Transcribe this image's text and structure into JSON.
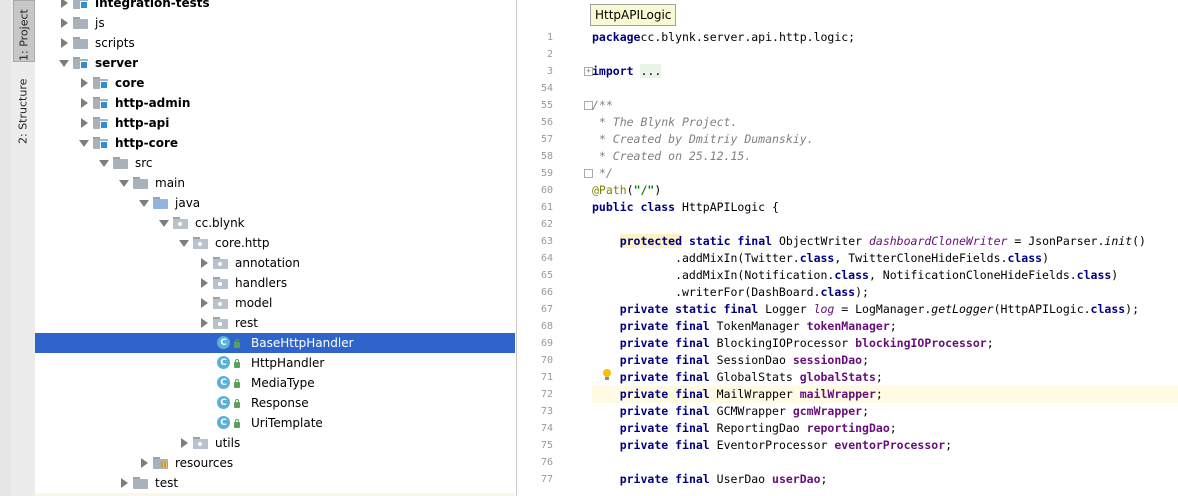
{
  "toolwindow": {
    "project_label": "1: Project",
    "structure_label": "2: Structure"
  },
  "tree": {
    "rows": [
      {
        "label": "integration-tests",
        "arrow": "right",
        "icon": "module-folder",
        "bold": true
      },
      {
        "label": "js",
        "arrow": "right",
        "icon": "folder",
        "bold": false
      },
      {
        "label": "scripts",
        "arrow": "right",
        "icon": "folder",
        "bold": false
      },
      {
        "label": "server",
        "arrow": "down",
        "icon": "module-folder",
        "bold": true
      },
      {
        "label": "core",
        "arrow": "right",
        "icon": "module-folder",
        "bold": true
      },
      {
        "label": "http-admin",
        "arrow": "right",
        "icon": "module-folder",
        "bold": true
      },
      {
        "label": "http-api",
        "arrow": "right",
        "icon": "module-folder",
        "bold": true
      },
      {
        "label": "http-core",
        "arrow": "down",
        "icon": "module-folder",
        "bold": true
      },
      {
        "label": "src",
        "arrow": "down",
        "icon": "folder",
        "bold": false
      },
      {
        "label": "main",
        "arrow": "down",
        "icon": "folder",
        "bold": false
      },
      {
        "label": "java",
        "arrow": "down",
        "icon": "source-folder",
        "bold": false
      },
      {
        "label": "cc.blynk",
        "arrow": "down",
        "icon": "package",
        "bold": false
      },
      {
        "label": "core.http",
        "arrow": "down",
        "icon": "package",
        "bold": false
      },
      {
        "label": "annotation",
        "arrow": "right",
        "icon": "package",
        "bold": false
      },
      {
        "label": "handlers",
        "arrow": "right",
        "icon": "package",
        "bold": false
      },
      {
        "label": "model",
        "arrow": "right",
        "icon": "package",
        "bold": false
      },
      {
        "label": "rest",
        "arrow": "right",
        "icon": "package",
        "bold": false
      },
      {
        "label": "BaseHttpHandler",
        "arrow": "",
        "icon": "class",
        "bold": false,
        "selected": true
      },
      {
        "label": "HttpHandler",
        "arrow": "",
        "icon": "class",
        "bold": false
      },
      {
        "label": "MediaType",
        "arrow": "",
        "icon": "class",
        "bold": false
      },
      {
        "label": "Response",
        "arrow": "",
        "icon": "class",
        "bold": false
      },
      {
        "label": "UriTemplate",
        "arrow": "",
        "icon": "class",
        "bold": false
      },
      {
        "label": "utils",
        "arrow": "right",
        "icon": "package",
        "bold": false
      },
      {
        "label": "resources",
        "arrow": "right",
        "icon": "resources-folder",
        "bold": false
      },
      {
        "label": "test",
        "arrow": "right",
        "icon": "folder",
        "bold": false
      }
    ],
    "class_icon_letter": "C"
  },
  "editor": {
    "breadcrumb": "HttpAPILogic",
    "lines": [
      {
        "n": "1",
        "t": [
          [
            "kw",
            "package"
          ],
          [
            "",
            "cc.blynk.server.api.http.logic;"
          ]
        ]
      },
      {
        "n": "2",
        "t": []
      },
      {
        "n": "3",
        "t": [
          [
            "kw",
            "import"
          ],
          [
            "",
            " "
          ],
          [
            "fold-txt",
            "..."
          ]
        ],
        "fold": "+"
      },
      {
        "n": "54",
        "t": []
      },
      {
        "n": "55",
        "t": [
          [
            "cmt",
            "/**"
          ]
        ],
        "fold": "-"
      },
      {
        "n": "56",
        "t": [
          [
            "cmt",
            " * The Blynk Project."
          ]
        ]
      },
      {
        "n": "57",
        "t": [
          [
            "cmt",
            " * Created by Dmitriy Dumanskiy."
          ]
        ]
      },
      {
        "n": "58",
        "t": [
          [
            "cmt",
            " * Created on 25.12.15."
          ]
        ]
      },
      {
        "n": "59",
        "t": [
          [
            "cmt",
            " */"
          ]
        ],
        "fold": "-"
      },
      {
        "n": "60",
        "t": [
          [
            "ann",
            "@Path"
          ],
          [
            "",
            "("
          ],
          [
            "str",
            "\"/\""
          ],
          [
            "",
            ")"
          ]
        ]
      },
      {
        "n": "61",
        "t": [
          [
            "kw",
            "public class"
          ],
          [
            "",
            " HttpAPILogic {"
          ]
        ]
      },
      {
        "n": "62",
        "t": []
      },
      {
        "n": "63",
        "t": [
          [
            "",
            "    "
          ],
          [
            "kw hl",
            "protected"
          ],
          [
            "",
            " "
          ],
          [
            "kw",
            "static final"
          ],
          [
            "",
            " ObjectWriter "
          ],
          [
            "ifld",
            "dashboardCloneWriter"
          ],
          [
            "",
            " = JsonParser."
          ],
          [
            "mit",
            "init"
          ],
          [
            "",
            "()"
          ]
        ]
      },
      {
        "n": "64",
        "t": [
          [
            "",
            "            .addMixIn(Twitter."
          ],
          [
            "kw",
            "class"
          ],
          [
            "",
            ", TwitterCloneHideFields."
          ],
          [
            "kw",
            "class"
          ],
          [
            ")"
          ]
        ]
      },
      {
        "n": "65",
        "t": [
          [
            "",
            "            .addMixIn(Notification."
          ],
          [
            "kw",
            "class"
          ],
          [
            "",
            ", NotificationCloneHideFields."
          ],
          [
            "kw",
            "class"
          ],
          [
            ")"
          ]
        ]
      },
      {
        "n": "66",
        "t": [
          [
            "",
            "            .writerFor(DashBoard."
          ],
          [
            "kw",
            "class"
          ],
          [
            "",
            ");"
          ]
        ]
      },
      {
        "n": "67",
        "t": [
          [
            "",
            "    "
          ],
          [
            "kw",
            "private static final"
          ],
          [
            "",
            " Logger "
          ],
          [
            "ifld",
            "log"
          ],
          [
            "",
            " = LogManager."
          ],
          [
            "mit",
            "getLogger"
          ],
          [
            "",
            "(HttpAPILogic."
          ],
          [
            "kw",
            "class"
          ],
          [
            "",
            ");"
          ]
        ]
      },
      {
        "n": "68",
        "t": [
          [
            "",
            "    "
          ],
          [
            "kw",
            "private final"
          ],
          [
            "",
            " TokenManager "
          ],
          [
            "fld",
            "tokenManager"
          ],
          [
            ";"
          ]
        ]
      },
      {
        "n": "69",
        "t": [
          [
            "",
            "    "
          ],
          [
            "kw",
            "private final"
          ],
          [
            "",
            " BlockingIOProcessor "
          ],
          [
            "fld",
            "blockingIOProcessor"
          ],
          [
            ";"
          ]
        ]
      },
      {
        "n": "70",
        "t": [
          [
            "",
            "    "
          ],
          [
            "kw",
            "private final"
          ],
          [
            "",
            " SessionDao "
          ],
          [
            "fld",
            "sessionDao"
          ],
          [
            ";"
          ]
        ]
      },
      {
        "n": "71",
        "t": [
          [
            "",
            "    "
          ],
          [
            "kw",
            "private final"
          ],
          [
            "",
            " GlobalStats "
          ],
          [
            "fld",
            "globalStats"
          ],
          [
            ";"
          ]
        ]
      },
      {
        "n": "72",
        "t": [
          [
            "",
            "    "
          ],
          [
            "kw",
            "private final"
          ],
          [
            "",
            " MailWrapper "
          ],
          [
            "fld",
            "mailWrapper"
          ],
          [
            ";"
          ]
        ],
        "current": true
      },
      {
        "n": "73",
        "t": [
          [
            "",
            "    "
          ],
          [
            "kw",
            "private final"
          ],
          [
            "",
            " GCMWrapper "
          ],
          [
            "fld",
            "gcmWrapper"
          ],
          [
            ";"
          ]
        ]
      },
      {
        "n": "74",
        "t": [
          [
            "",
            "    "
          ],
          [
            "kw",
            "private final"
          ],
          [
            "",
            " ReportingDao "
          ],
          [
            "fld",
            "reportingDao"
          ],
          [
            ";"
          ]
        ]
      },
      {
        "n": "75",
        "t": [
          [
            "",
            "    "
          ],
          [
            "kw",
            "private final"
          ],
          [
            "",
            " EventorProcessor "
          ],
          [
            "fld",
            "eventorProcessor"
          ],
          [
            ";"
          ]
        ]
      },
      {
        "n": "76",
        "t": []
      },
      {
        "n": "77",
        "t": [
          [
            "",
            "    "
          ],
          [
            "kw",
            "private final"
          ],
          [
            "",
            " UserDao "
          ],
          [
            "fld",
            "userDao"
          ],
          [
            ";"
          ]
        ]
      }
    ]
  }
}
